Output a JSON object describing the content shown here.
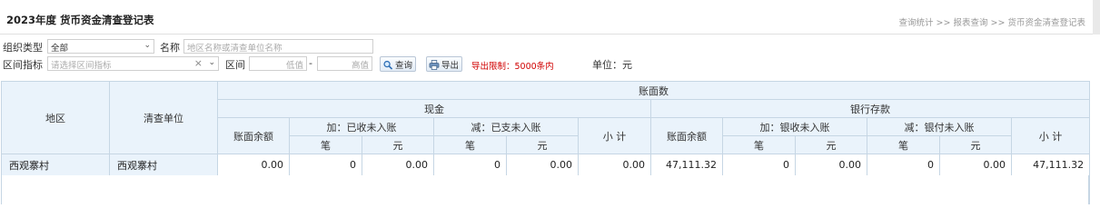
{
  "header": {
    "title": "2023年度 货币资金清查登记表",
    "breadcrumbs": [
      "查询统计",
      "报表查询",
      "货币资金清查登记表"
    ],
    "breadcrumb_sep": ">>"
  },
  "filters": {
    "org_type_label": "组织类型",
    "org_type_value": "全部",
    "name_label": "名称",
    "name_placeholder": "地区名称或清查单位名称",
    "range_indicator_label": "区间指标",
    "range_indicator_placeholder": "请选择区间指标",
    "range_label": "区间",
    "range_low_placeholder": "低值",
    "range_dash": "-",
    "range_high_placeholder": "高值",
    "query_button": "查询",
    "export_button": "导出",
    "export_limit": "导出限制：5000条内",
    "unit": "单位：元"
  },
  "table": {
    "headers": {
      "region": "地区",
      "unit": "清查单位",
      "book_count": "账面数",
      "cash": "现金",
      "bank": "银行存款",
      "book_balance": "账面余额",
      "add_received": "加：已收未入账",
      "minus_paid": "减：已支未入账",
      "add_bank_received": "加：银收未入账",
      "minus_bank_paid": "减：银付未入账",
      "subtotal": "小 计",
      "count": "笔",
      "amount": "元"
    },
    "rows": [
      {
        "region": "西观寨村",
        "unit": "西观寨村",
        "cash_balance": "0.00",
        "cash_add_count": "0",
        "cash_add_amount": "0.00",
        "cash_minus_count": "0",
        "cash_minus_amount": "0.00",
        "cash_subtotal": "0.00",
        "bank_balance": "47,111.32",
        "bank_add_count": "0",
        "bank_add_amount": "0.00",
        "bank_minus_count": "0",
        "bank_minus_amount": "0.00",
        "bank_subtotal": "47,111.32"
      }
    ]
  },
  "colors": {
    "header_bg": "#eaf3fb",
    "border": "#c6d6e4",
    "limit_text": "#d00000"
  },
  "icons": {
    "query": "search-icon",
    "export": "printer-icon",
    "dropdown": "chevron-down-icon",
    "clear": "clear-icon"
  }
}
